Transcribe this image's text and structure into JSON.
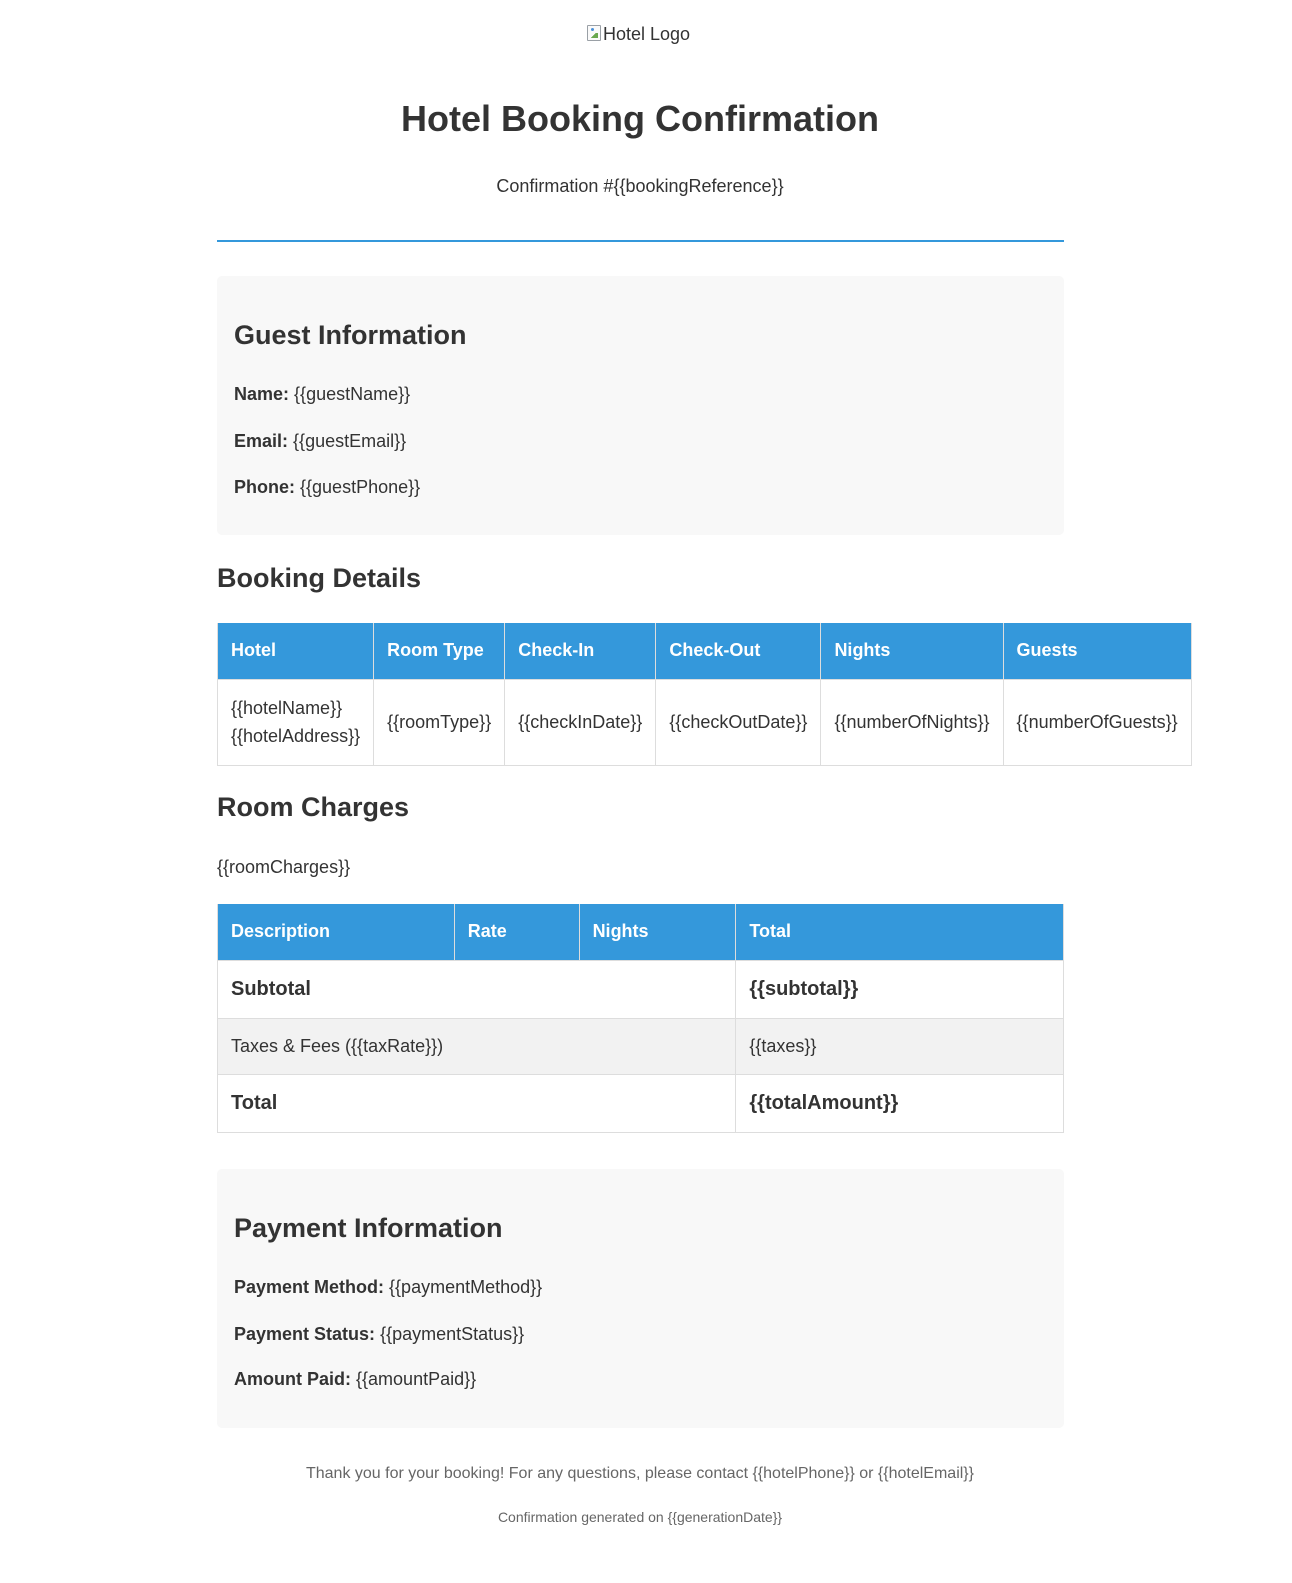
{
  "logo": {
    "alt": "Hotel Logo"
  },
  "header": {
    "title": "Hotel Booking Confirmation",
    "confirmation": "Confirmation #{{bookingReference}}"
  },
  "guest": {
    "title": "Guest Information",
    "name_label": "Name:",
    "name_value": "{{guestName}}",
    "email_label": "Email:",
    "email_value": "{{guestEmail}}",
    "phone_label": "Phone:",
    "phone_value": "{{guestPhone}}"
  },
  "booking": {
    "title": "Booking Details",
    "headers": [
      "Hotel",
      "Room Type",
      "Check-In",
      "Check-Out",
      "Nights",
      "Guests"
    ],
    "hotel_name": "{{hotelName}}",
    "hotel_address": "{{hotelAddress}}",
    "room_type": "{{roomType}}",
    "check_in": "{{checkInDate}}",
    "check_out": "{{checkOutDate}}",
    "nights": "{{numberOfNights}}",
    "guests": "{{numberOfGuests}}"
  },
  "charges": {
    "title": "Room Charges",
    "placeholder": "{{roomCharges}}",
    "headers": [
      "Description",
      "Rate",
      "Nights",
      "Total"
    ],
    "subtotal_label": "Subtotal",
    "subtotal_value": "{{subtotal}}",
    "taxes_label": "Taxes & Fees ({{taxRate}})",
    "taxes_value": "{{taxes}}",
    "total_label": "Total",
    "total_value": "{{totalAmount}}"
  },
  "payment": {
    "title": "Payment Information",
    "method_label": "Payment Method:",
    "method_value": "{{paymentMethod}}",
    "status_label": "Payment Status:",
    "status_value": "{{paymentStatus}}",
    "amount_label": "Amount Paid:",
    "amount_value": "{{amountPaid}}"
  },
  "footer": {
    "thanks": "Thank you for your booking! For any questions, please contact {{hotelPhone}} or {{hotelEmail}}",
    "generated": "Confirmation generated on {{generationDate}}"
  }
}
